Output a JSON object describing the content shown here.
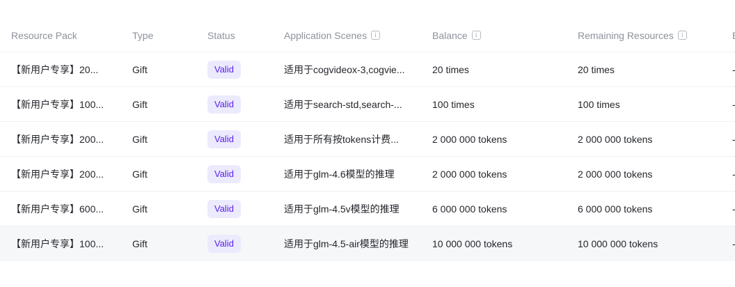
{
  "table": {
    "columns": {
      "resource_pack": "Resource Pack",
      "type": "Type",
      "status": "Status",
      "application_scenes": "Application Scenes",
      "balance": "Balance",
      "remaining_resources": "Remaining Resources",
      "clipped_header_fragment": "E"
    },
    "info_icon_glyph": "i",
    "rows": [
      {
        "pack": "【新用户专享】20...",
        "type": "Gift",
        "status": "Valid",
        "scenes": "适用于cogvideox-3,cogvie...",
        "balance": "20 times",
        "remaining": "20 times",
        "clipped": "-"
      },
      {
        "pack": "【新用户专享】100...",
        "type": "Gift",
        "status": "Valid",
        "scenes": "适用于search-std,search-...",
        "balance": "100 times",
        "remaining": "100 times",
        "clipped": "-"
      },
      {
        "pack": "【新用户专享】200...",
        "type": "Gift",
        "status": "Valid",
        "scenes": "适用于所有按tokens计费...",
        "balance": "2 000 000 tokens",
        "remaining": "2 000 000 tokens",
        "clipped": "-"
      },
      {
        "pack": "【新用户专享】200...",
        "type": "Gift",
        "status": "Valid",
        "scenes": "适用于glm-4.6模型的推理",
        "balance": "2 000 000 tokens",
        "remaining": "2 000 000 tokens",
        "clipped": "-"
      },
      {
        "pack": "【新用户专享】600...",
        "type": "Gift",
        "status": "Valid",
        "scenes": "适用于glm-4.5v模型的推理",
        "balance": "6 000 000 tokens",
        "remaining": "6 000 000 tokens",
        "clipped": "-"
      },
      {
        "pack": "【新用户专享】100...",
        "type": "Gift",
        "status": "Valid",
        "scenes": "适用于glm-4.5-air模型的推理",
        "balance": "10 000 000 tokens",
        "remaining": "10 000 000 tokens",
        "clipped": "-"
      }
    ]
  },
  "colors": {
    "header_text": "#8d929b",
    "body_text": "#24262b",
    "badge_background": "#eceafd",
    "badge_text": "#5a20f0",
    "row_divider": "#f0f0f0",
    "highlighted_row_background": "#f6f7f9"
  }
}
